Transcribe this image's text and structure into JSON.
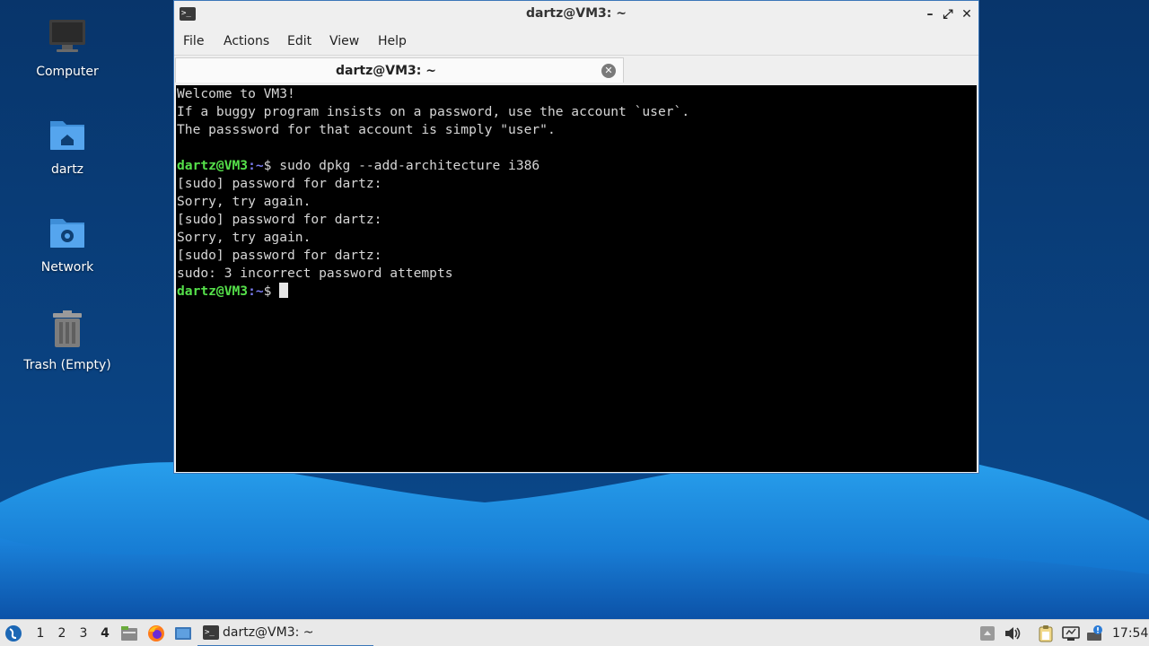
{
  "desktop": {
    "icons": [
      {
        "label": "Computer",
        "icon": "computer-icon"
      },
      {
        "label": "dartz",
        "icon": "home-folder-icon"
      },
      {
        "label": "Network",
        "icon": "network-folder-icon"
      },
      {
        "label": "Trash (Empty)",
        "icon": "trash-icon"
      }
    ]
  },
  "window": {
    "title": "dartz@VM3: ~",
    "controls": {
      "minimize": "–",
      "maximize": "⤢",
      "close": "✕"
    },
    "menu": [
      "File",
      "Actions",
      "Edit",
      "View",
      "Help"
    ],
    "tab": {
      "label": "dartz@VM3: ~",
      "close_glyph": "✕"
    }
  },
  "terminal": {
    "lines": [
      {
        "text": "Welcome to VM3!"
      },
      {
        "text": "If a buggy program insists on a password, use the account `user`."
      },
      {
        "text": "The passsword for that account is simply \"user\"."
      },
      {
        "text": ""
      },
      {
        "user": "dartz@VM3",
        "path": ":~",
        "prompt": "$ ",
        "text": "sudo dpkg --add-architecture i386"
      },
      {
        "text": "[sudo] password for dartz:"
      },
      {
        "text": "Sorry, try again."
      },
      {
        "text": "[sudo] password for dartz:"
      },
      {
        "text": "Sorry, try again."
      },
      {
        "text": "[sudo] password for dartz:"
      },
      {
        "text": "sudo: 3 incorrect password attempts"
      },
      {
        "user": "dartz@VM3",
        "path": ":~",
        "prompt": "$ ",
        "text": "",
        "cursor": true
      }
    ],
    "colors": {
      "user": "#55e04a",
      "path": "#7a7cf0",
      "background": "#000000",
      "text": "#d6d6d6"
    }
  },
  "taskbar": {
    "workspaces": [
      "1",
      "2",
      "3",
      "4"
    ],
    "active_workspace": "4",
    "launchers": [
      "start-menu-icon",
      "file-manager-icon",
      "firefox-icon",
      "show-desktop-icon"
    ],
    "task": {
      "label": "dartz@VM3: ~",
      "icon": "terminal-icon"
    },
    "tray": [
      "notification-up-icon",
      "volume-icon",
      "clipboard-icon",
      "network-icon",
      "update-icon"
    ],
    "clock": "17:54"
  },
  "colors": {
    "accent": "#3b77b8",
    "desktop_bg": "#0a3a73",
    "wave": "#1e90e0"
  }
}
